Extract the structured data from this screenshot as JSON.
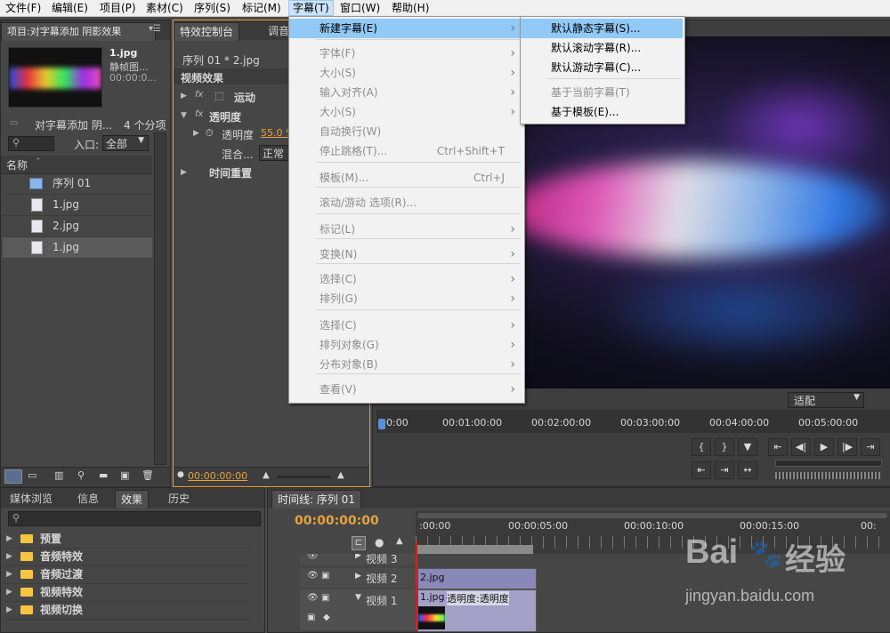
{
  "menubar": {
    "items": [
      "文件(F)",
      "编辑(E)",
      "项目(P)",
      "素材(C)",
      "序列(S)",
      "标记(M)",
      "字幕(T)",
      "窗口(W)",
      "帮助(H)"
    ]
  },
  "project_panel": {
    "tab_label": "项目:对字幕添加 阴影效果",
    "thumb_name": "1.jpg",
    "thumb_type": "静帧图...",
    "thumb_time": "00:00:0...",
    "bin_name": "对字幕添加 阴...",
    "item_count": "4 个分项",
    "in_label": "入口:",
    "in_value": "全部",
    "col_name": "名称",
    "items": [
      "序列 01",
      "1.jpg",
      "2.jpg",
      "1.jpg"
    ]
  },
  "effect_controls": {
    "tabs": [
      "特效控制台",
      "调音"
    ],
    "source_label": "序列 01 * 2.jpg",
    "section": "视频效果",
    "motion": "运动",
    "opacity": "透明度",
    "opacity_prop": "透明度",
    "opacity_value": "55.0 %",
    "blend_label": "混合...",
    "blend_value": "正常",
    "time_remap": "时间重置",
    "timecode": "00:00:00:00"
  },
  "title_menu": {
    "items": [
      {
        "label": "新建字幕(E)",
        "shortcut": "",
        "arrow": true,
        "disabled": false,
        "highlighted": true
      },
      {
        "label": "字体(F)",
        "shortcut": "",
        "arrow": true,
        "disabled": true
      },
      {
        "label": "大小(S)",
        "shortcut": "",
        "arrow": true,
        "disabled": true
      },
      {
        "label": "输入对齐(A)",
        "shortcut": "",
        "arrow": true,
        "disabled": true
      },
      {
        "label": "大小(S)",
        "shortcut": "",
        "arrow": true,
        "disabled": true
      },
      {
        "label": "自动换行(W)",
        "shortcut": "",
        "arrow": false,
        "disabled": true
      },
      {
        "label": "停止跳格(T)...",
        "shortcut": "Ctrl+Shift+T",
        "arrow": false,
        "disabled": true
      },
      {
        "label": "模板(M)...",
        "shortcut": "Ctrl+J",
        "arrow": false,
        "disabled": true
      },
      {
        "label": "滚动/游动 选项(R)...",
        "shortcut": "",
        "arrow": false,
        "disabled": true
      },
      {
        "label": "标记(L)",
        "shortcut": "",
        "arrow": true,
        "disabled": true
      },
      {
        "label": "变换(N)",
        "shortcut": "",
        "arrow": true,
        "disabled": true
      },
      {
        "label": "选择(C)",
        "shortcut": "",
        "arrow": true,
        "disabled": true
      },
      {
        "label": "排列(G)",
        "shortcut": "",
        "arrow": true,
        "disabled": true
      },
      {
        "label": "选择(C)",
        "shortcut": "",
        "arrow": true,
        "disabled": true
      },
      {
        "label": "排列对象(G)",
        "shortcut": "",
        "arrow": true,
        "disabled": true
      },
      {
        "label": "分布对象(B)",
        "shortcut": "",
        "arrow": true,
        "disabled": true
      },
      {
        "label": "查看(V)",
        "shortcut": "",
        "arrow": true,
        "disabled": true
      }
    ]
  },
  "new_title_submenu": {
    "items": [
      {
        "label": "默认静态字幕(S)...",
        "disabled": false,
        "highlighted": true
      },
      {
        "label": "默认滚动字幕(R)...",
        "disabled": false
      },
      {
        "label": "默认游动字幕(C)...",
        "disabled": false
      },
      {
        "label": "基于当前字幕(T)",
        "disabled": true
      },
      {
        "label": "基于模板(E)...",
        "disabled": false
      }
    ]
  },
  "program_monitor": {
    "fit_value": "适配",
    "ruler": [
      "00:00",
      "00:01:00:00",
      "00:02:00:00",
      "00:03:00:00",
      "00:04:00:00",
      "00:05:00:00"
    ]
  },
  "effects_panel": {
    "tabs": [
      "媒体浏览",
      "信息",
      "效果",
      "历史"
    ],
    "folders": [
      "预置",
      "音频特效",
      "音频过渡",
      "视频特效",
      "视频切换"
    ]
  },
  "timeline": {
    "tab_label": "时间线: 序列 01",
    "timecode": "00:00:00:00",
    "ruler": [
      ":00:00",
      "00:00:05:00",
      "00:00:10:00",
      "00:00:15:00",
      "00:"
    ],
    "tracks": [
      "视频 3",
      "视频 2",
      "视频 1"
    ],
    "clip_v2": "2.jpg",
    "clip_v1": "1.jpg",
    "clip_v1_effect": "透明度:透明度"
  },
  "watermark": {
    "brand": "Bai",
    "brand2": "经验",
    "url": "jingyan.baidu.com"
  }
}
